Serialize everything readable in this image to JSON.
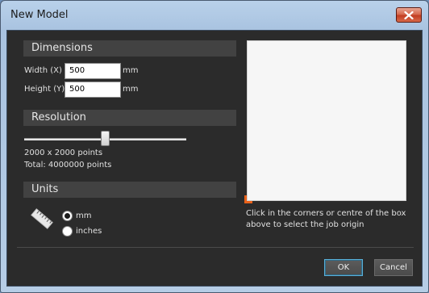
{
  "window": {
    "title": "New Model"
  },
  "dimensions": {
    "header": "Dimensions",
    "width_label": "Width (X)",
    "width_value": "500",
    "width_unit": "mm",
    "height_label": "Height (Y)",
    "height_value": "500",
    "height_unit": "mm"
  },
  "resolution": {
    "header": "Resolution",
    "slider_fraction": 0.5,
    "points_text": "2000 x 2000 points",
    "total_text": "Total: 4000000 points"
  },
  "units": {
    "header": "Units",
    "icon": "ruler-icon",
    "options": [
      {
        "label": "mm",
        "checked": true
      },
      {
        "label": "inches",
        "checked": false
      }
    ]
  },
  "origin": {
    "hint_line1": "Click in the corners or centre of the box",
    "hint_line2": "above to select the job origin",
    "marker_color": "#e8611a"
  },
  "buttons": {
    "ok": "OK",
    "cancel": "Cancel"
  },
  "colors": {
    "accent": "#5ab0d8",
    "panel": "#2b2b2b",
    "section_header": "#424242"
  }
}
